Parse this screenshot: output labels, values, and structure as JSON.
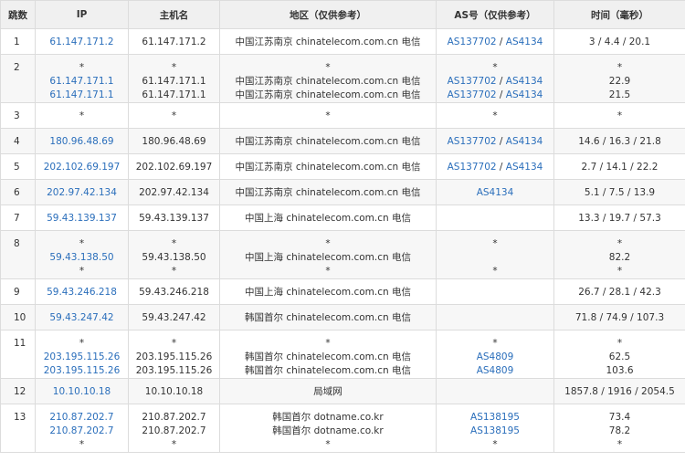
{
  "headers": {
    "hop": "跳数",
    "ip": "IP",
    "hostname": "主机名",
    "region": "地区（仅供参考）",
    "as": "AS号（仅供参考）",
    "time": "时间（毫秒）"
  },
  "colors": {
    "link": "#2a6ebb",
    "header_bg": "#f0f0f0",
    "border": "#dcdcdc",
    "text": "#333333"
  },
  "rows": [
    {
      "hop": "1",
      "ip": "61.147.171.2",
      "host": "61.147.171.2",
      "region": "中国江苏南京 chinatelecom.com.cn 电信",
      "as1": "AS137702",
      "as_sep": " / ",
      "as2": "AS4134",
      "time": "3 / 4.4 / 20.1"
    },
    {
      "hop": "2",
      "l1": {
        "ip": "*",
        "host": "*",
        "region": "*",
        "as": "*",
        "time": "*"
      },
      "l2": {
        "ip": "61.147.171.1",
        "host": "61.147.171.1",
        "region": "中国江苏南京 chinatelecom.com.cn 电信",
        "as1": "AS137702",
        "as_sep": " / ",
        "as2": "AS4134",
        "time": "22.9"
      },
      "l3": {
        "ip": "61.147.171.1",
        "host": "61.147.171.1",
        "region": "中国江苏南京 chinatelecom.com.cn 电信",
        "as1": "AS137702",
        "as_sep": " / ",
        "as2": "AS4134",
        "time": "21.5"
      }
    },
    {
      "hop": "3",
      "ip": "*",
      "host": "*",
      "region": "*",
      "as": "*",
      "time": "*"
    },
    {
      "hop": "4",
      "ip": "180.96.48.69",
      "host": "180.96.48.69",
      "region": "中国江苏南京 chinatelecom.com.cn 电信",
      "as1": "AS137702",
      "as_sep": " / ",
      "as2": "AS4134",
      "time": "14.6 / 16.3 / 21.8"
    },
    {
      "hop": "5",
      "ip": "202.102.69.197",
      "host": "202.102.69.197",
      "region": "中国江苏南京 chinatelecom.com.cn 电信",
      "as1": "AS137702",
      "as_sep": " / ",
      "as2": "AS4134",
      "time": "2.7 / 14.1 / 22.2"
    },
    {
      "hop": "6",
      "ip": "202.97.42.134",
      "host": "202.97.42.134",
      "region": "中国江苏南京 chinatelecom.com.cn 电信",
      "as1": "AS4134",
      "time": "5.1 / 7.5 / 13.9"
    },
    {
      "hop": "7",
      "ip": "59.43.139.137",
      "host": "59.43.139.137",
      "region": "中国上海 chinatelecom.com.cn 电信",
      "time": "13.3 / 19.7 / 57.3"
    },
    {
      "hop": "8",
      "l1": {
        "ip": "*",
        "host": "*",
        "region": "*",
        "as": "*",
        "time": "*"
      },
      "l2": {
        "ip": "59.43.138.50",
        "host": "59.43.138.50",
        "region": "中国上海 chinatelecom.com.cn 电信",
        "time": "82.2"
      },
      "l3": {
        "ip": "*",
        "host": "*",
        "region": "*",
        "as": "*",
        "time": "*"
      }
    },
    {
      "hop": "9",
      "ip": "59.43.246.218",
      "host": "59.43.246.218",
      "region": "中国上海 chinatelecom.com.cn 电信",
      "time": "26.7 / 28.1 / 42.3"
    },
    {
      "hop": "10",
      "ip": "59.43.247.42",
      "host": "59.43.247.42",
      "region": "韩国首尔 chinatelecom.com.cn 电信",
      "time": "71.8 / 74.9 / 107.3"
    },
    {
      "hop": "11",
      "l1": {
        "ip": "*",
        "host": "*",
        "region": "*",
        "as": "*",
        "time": "*"
      },
      "l2": {
        "ip": "203.195.115.26",
        "host": "203.195.115.26",
        "region": "韩国首尔 chinatelecom.com.cn 电信",
        "as1": "AS4809",
        "time": "62.5"
      },
      "l3": {
        "ip": "203.195.115.26",
        "host": "203.195.115.26",
        "region": "韩国首尔 chinatelecom.com.cn 电信",
        "as1": "AS4809",
        "time": "103.6"
      }
    },
    {
      "hop": "12",
      "ip": "10.10.10.18",
      "host": "10.10.10.18",
      "region": "局域网",
      "time": "1857.8 / 1916 / 2054.5"
    },
    {
      "hop": "13",
      "l1": {
        "ip": "210.87.202.7",
        "host": "210.87.202.7",
        "region": "韩国首尔 dotname.co.kr",
        "as1": "AS138195",
        "time": "73.4"
      },
      "l2": {
        "ip": "210.87.202.7",
        "host": "210.87.202.7",
        "region": "韩国首尔 dotname.co.kr",
        "as1": "AS138195",
        "time": "78.2"
      },
      "l3": {
        "ip": "*",
        "host": "*",
        "region": "*",
        "as": "*",
        "time": "*"
      }
    }
  ]
}
